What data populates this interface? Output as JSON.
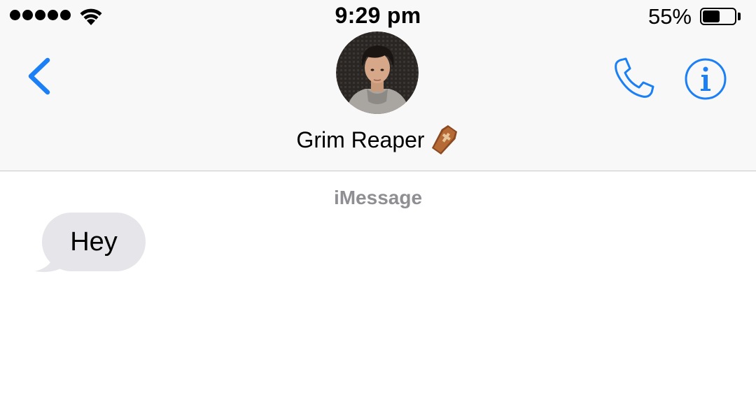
{
  "status_bar": {
    "time": "9:29 pm",
    "battery_percent": "55%",
    "battery_level": 0.55,
    "signal_bars": 5
  },
  "nav": {
    "back_icon": "chevron-left-icon",
    "contact_name": "Grim Reaper",
    "contact_emoji": "coffin-emoji",
    "call_icon": "phone-icon",
    "info_icon": "info-icon"
  },
  "conversation": {
    "service_label": "iMessage",
    "messages": [
      {
        "direction": "incoming",
        "text": "Hey"
      }
    ]
  },
  "colors": {
    "accent": "#1b7ff5",
    "incoming_bubble": "#e5e5ea",
    "secondary_text": "#8e8e93",
    "header_background": "#f8f8f8"
  }
}
